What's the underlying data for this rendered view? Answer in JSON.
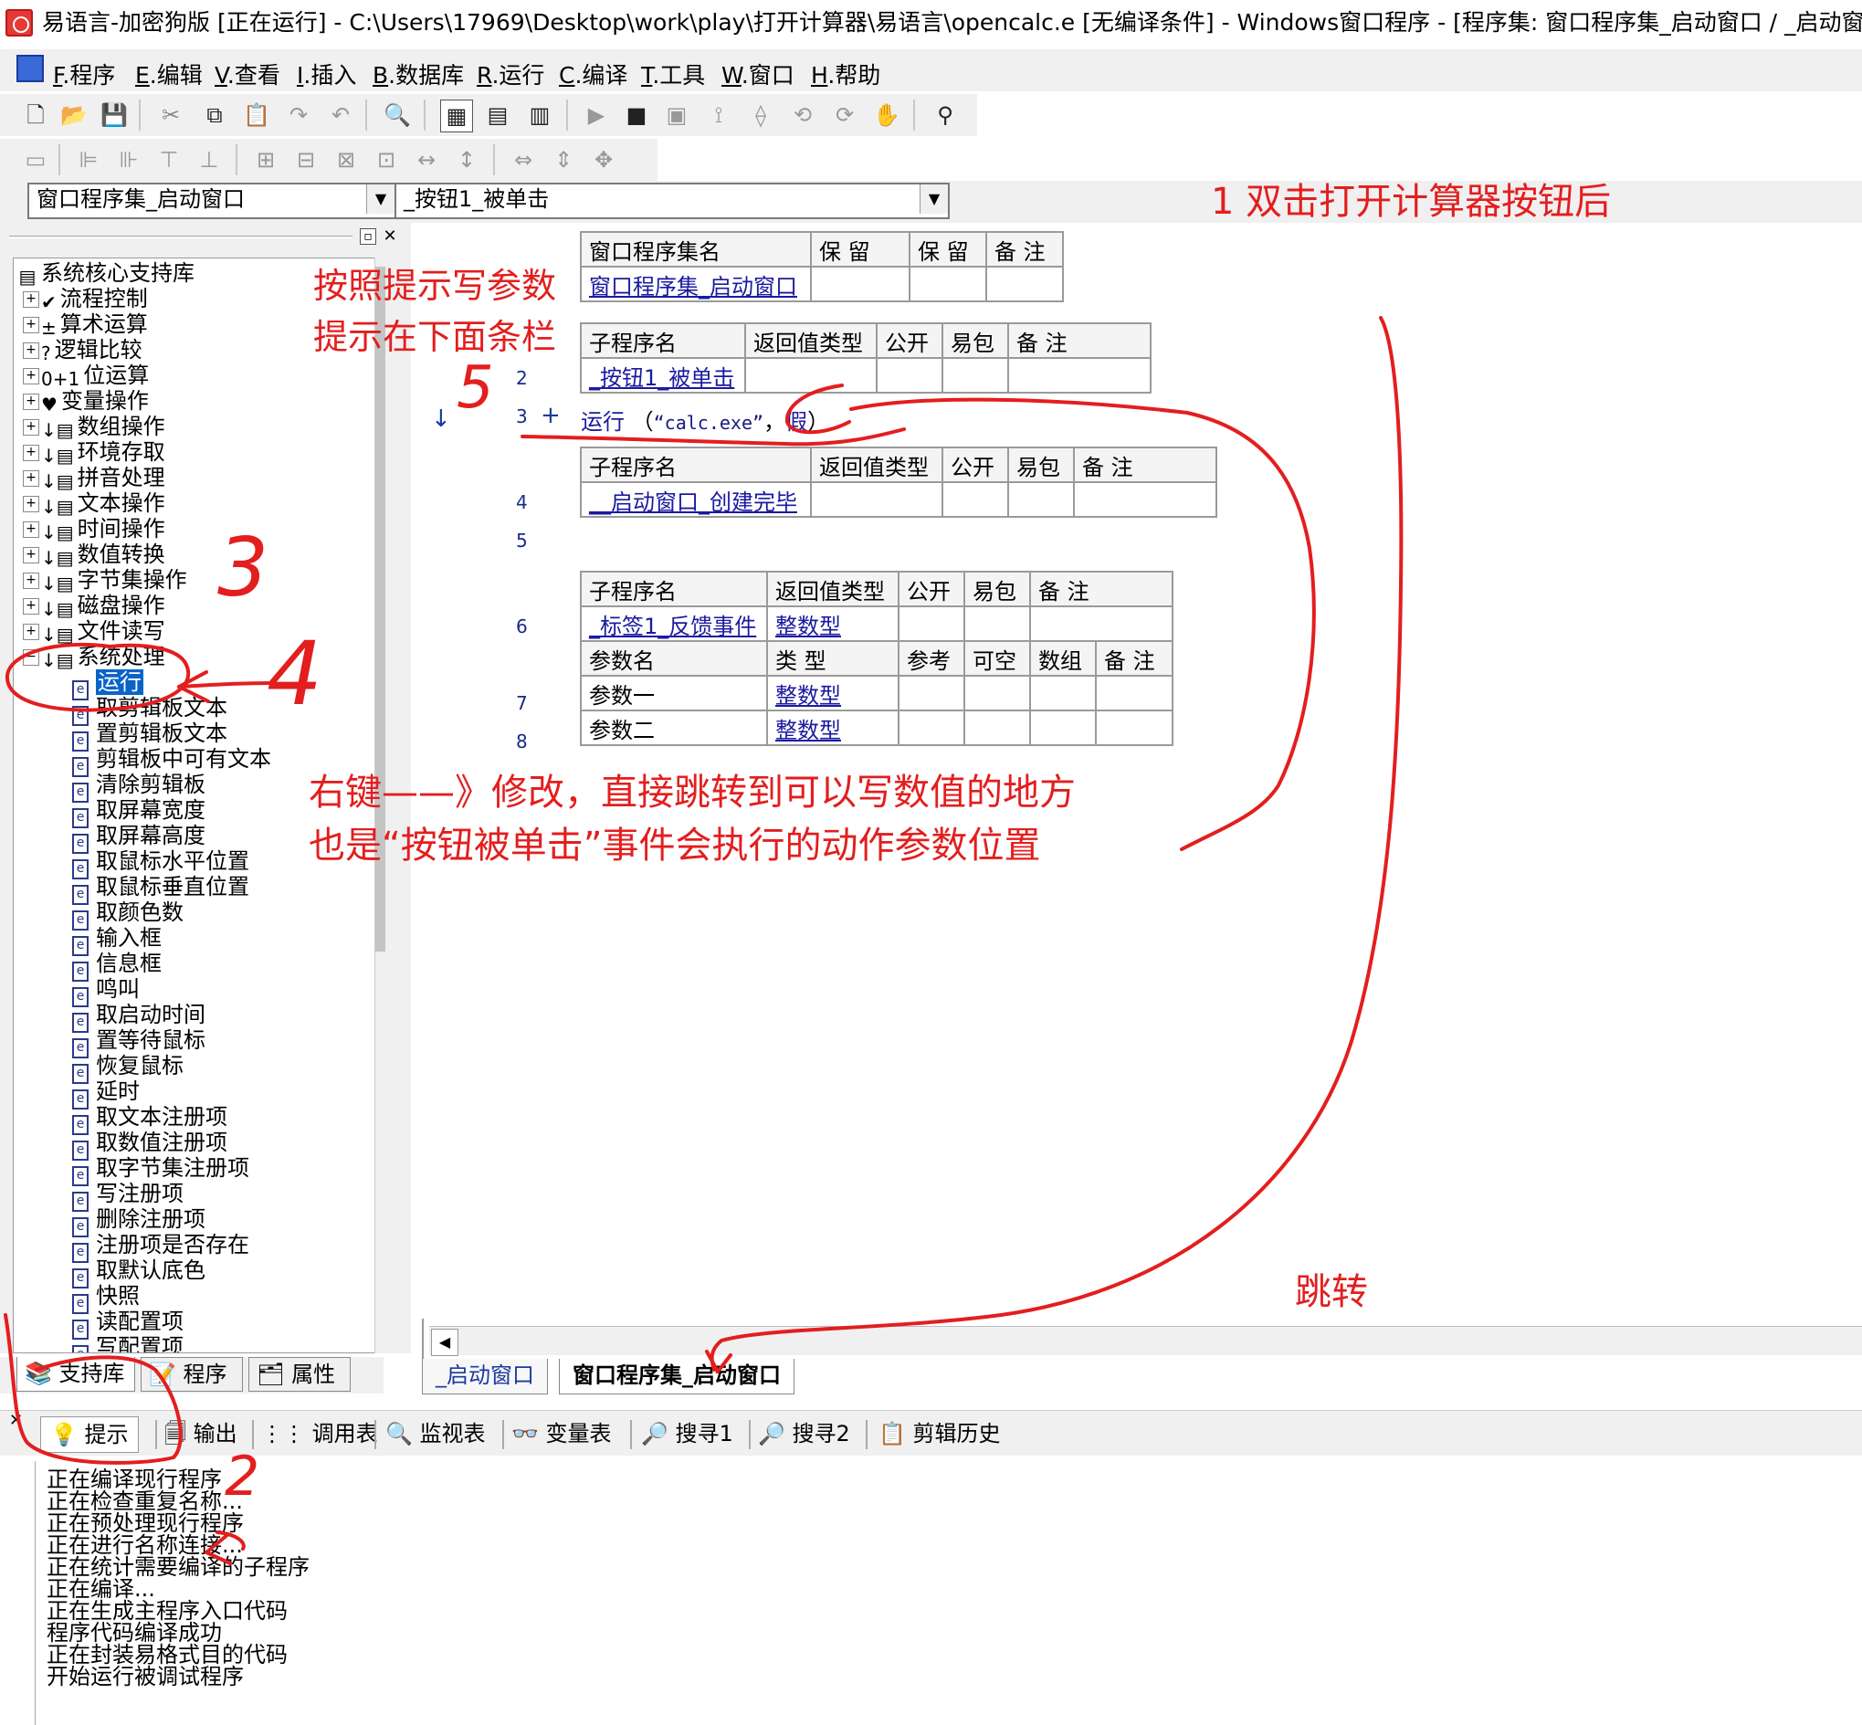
{
  "window": {
    "title": "易语言-加密狗版 [正在运行] - C:\\Users\\17969\\Desktop\\work\\play\\打开计算器\\易语言\\opencalc.e [无编译条件] - Windows窗口程序 - [程序集: 窗口程序集_启动窗口 / _启动窗口]"
  },
  "menu": [
    {
      "key": "F",
      "label": ".程序"
    },
    {
      "key": "E",
      "label": ".编辑"
    },
    {
      "key": "V",
      "label": ".查看"
    },
    {
      "key": "I",
      "label": ".插入"
    },
    {
      "key": "B",
      "label": ".数据库"
    },
    {
      "key": "R",
      "label": ".运行"
    },
    {
      "key": "C",
      "label": ".编译"
    },
    {
      "key": "T",
      "label": ".工具"
    },
    {
      "key": "W",
      "label": ".窗口"
    },
    {
      "key": "H",
      "label": ".帮助"
    }
  ],
  "combos": {
    "assembly": "窗口程序集_启动窗口",
    "sub": "_按钮1_被单击"
  },
  "tree": {
    "root": "系统核心支持库",
    "categories": [
      "流程控制",
      "算术运算",
      "逻辑比较",
      "位运算",
      "变量操作",
      "数组操作",
      "环境存取",
      "拼音处理",
      "文本操作",
      "时间操作",
      "数值转换",
      "字节集操作",
      "磁盘操作",
      "文件读写",
      "系统处理"
    ],
    "category_icons": {
      "流程控制": "✔",
      "算术运算": "±",
      "逻辑比较": "?",
      "位运算": "0+1",
      "变量操作": "♥"
    },
    "system_items": [
      "运行",
      "取剪辑板文本",
      "置剪辑板文本",
      "剪辑板中可有文本",
      "清除剪辑板",
      "取屏幕宽度",
      "取屏幕高度",
      "取鼠标水平位置",
      "取鼠标垂直位置",
      "取颜色数",
      "输入框",
      "信息框",
      "鸣叫",
      "取启动时间",
      "置等待鼠标",
      "恢复鼠标",
      "延时",
      "取文本注册项",
      "取数值注册项",
      "取字节集注册项",
      "写注册项",
      "删除注册项",
      "注册项是否存在",
      "取默认底色",
      "快照",
      "读配置项",
      "写配置项"
    ]
  },
  "left_tabs": [
    "支持库",
    "程序",
    "属性"
  ],
  "assembly_table": {
    "headers": [
      "窗口程序集名",
      "保 留",
      "保 留",
      "备 注"
    ],
    "row": [
      "窗口程序集_启动窗口",
      "",
      "",
      ""
    ]
  },
  "sub1": {
    "headers": [
      "子程序名",
      "返回值类型",
      "公开",
      "易包",
      "备 注"
    ],
    "row": [
      "_按钮1_被单击",
      "",
      "",
      "",
      ""
    ]
  },
  "code": {
    "run_cmd": "运行",
    "open_paren": "（",
    "arg1": "“calc.exe”",
    "comma": "，",
    "arg2": "假",
    "close_paren": "）",
    "plus": "+",
    "arrow": "↓"
  },
  "sub2": {
    "headers": [
      "子程序名",
      "返回值类型",
      "公开",
      "易包",
      "备 注"
    ],
    "row": [
      "__启动窗口_创建完毕",
      "",
      "",
      "",
      ""
    ]
  },
  "sub3": {
    "headers": [
      "子程序名",
      "返回值类型",
      "公开",
      "易包",
      "备 注"
    ],
    "row": [
      "_标签1_反馈事件",
      "整数型",
      "",
      "",
      ""
    ],
    "param_headers": [
      "参数名",
      "类 型",
      "参考",
      "可空",
      "数组",
      "备 注"
    ],
    "params": [
      [
        "参数一",
        "整数型",
        "",
        "",
        "",
        ""
      ],
      [
        "参数二",
        "整数型",
        "",
        "",
        "",
        ""
      ]
    ]
  },
  "line_numbers": [
    "2",
    "3",
    "4",
    "5",
    "6",
    "7",
    "8"
  ],
  "editor_tabs": [
    "_启动窗口",
    "窗口程序集_启动窗口"
  ],
  "output_tabs": [
    "提示",
    "输出",
    "调用表",
    "监视表",
    "变量表",
    "搜寻1",
    "搜寻2",
    "剪辑历史"
  ],
  "output_lines": [
    "正在编译现行程序",
    "正在检查重复名称...",
    "正在预处理现行程序",
    "正在进行名称连接...",
    "正在统计需要编译的子程序",
    "正在编译...",
    "正在生成主程序入口代码",
    "程序代码编译成功",
    "正在封装易格式目的代码",
    "开始运行被调试程序"
  ],
  "annotations": {
    "a1": "1 双击打开计算器按钮后",
    "a_hint1": "按照提示写参数",
    "a_hint2": "提示在下面条栏",
    "a_right1": "右键——》修改，直接跳转到可以写数值的地方",
    "a_right2": "也是“按钮被单击”事件会执行的动作参数位置",
    "a_jump": "跳转",
    "n2": "2",
    "n3": "3",
    "n4": "4",
    "n5": "5",
    "color": "#e31e1e"
  }
}
